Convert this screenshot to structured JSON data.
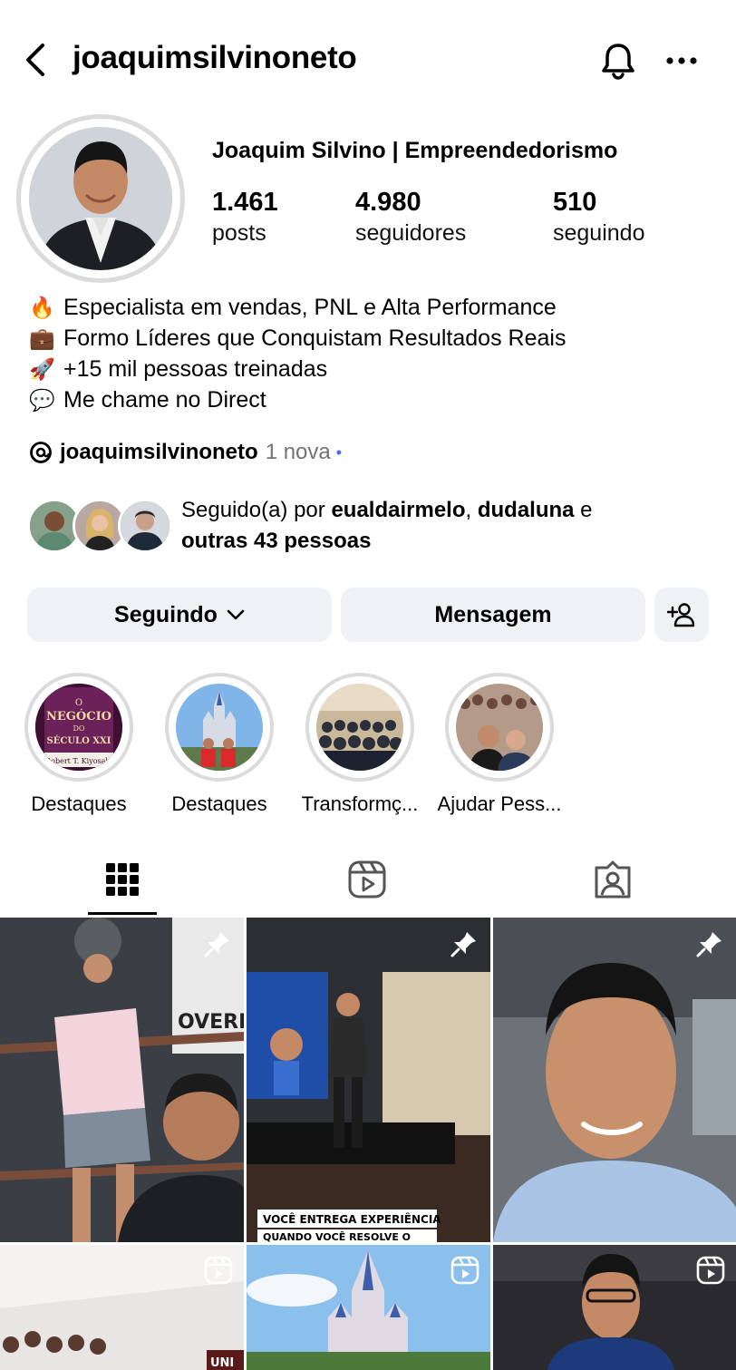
{
  "header": {
    "username": "joaquimsilvinoneto",
    "back_icon": "back-arrow-icon",
    "bell_icon": "bell-icon",
    "more_icon": "more-dots-icon"
  },
  "profile": {
    "display_name": "Joaquim Silvino | Empreendedorismo",
    "stats": {
      "posts": {
        "value": "1.461",
        "label": "posts"
      },
      "followers": {
        "value": "4.980",
        "label": "seguidores"
      },
      "following": {
        "value": "510",
        "label": "seguindo"
      }
    },
    "bio": [
      {
        "emoji": "🔥",
        "text": "Especialista em vendas, PNL e Alta Performance"
      },
      {
        "emoji": "💼",
        "text": "Formo Líderes que Conquistam Resultados Reais"
      },
      {
        "emoji": "🚀",
        "text": "+15 mil pessoas treinadas"
      },
      {
        "emoji": "💬",
        "text": "Me chame no Direct"
      }
    ],
    "threads": {
      "handle": "joaquimsilvinoneto",
      "badge": "1 nova",
      "dot": "•"
    },
    "followed_by": {
      "prefix": "Seguido(a) por ",
      "user1": "eualdairmelo",
      "sep": ", ",
      "user2": "dudaluna",
      "conj": " e",
      "others": "outras 43 pessoas"
    }
  },
  "actions": {
    "following_label": "Seguindo",
    "message_label": "Mensagem",
    "add_user_icon": "add-person-icon"
  },
  "highlights": [
    {
      "label": "Destaques",
      "book_title_1": "O",
      "book_title_2": "NEGÓCIO",
      "book_title_3": "DO",
      "book_title_4": "SÉCULO XXI",
      "book_author": "Robert T. Kiyosaki"
    },
    {
      "label": "Destaques"
    },
    {
      "label": "Transformç..."
    },
    {
      "label": "Ajudar Pess..."
    }
  ],
  "tabs": [
    "grid-icon",
    "reels-icon",
    "tagged-icon"
  ],
  "posts": [
    {
      "type": "pinned",
      "overlay": "OVERNO D"
    },
    {
      "type": "pinned",
      "caption1": "VOCÊ ENTREGA EXPERIÊNCIA",
      "caption2": "QUANDO VOCÊ RESOLVE O"
    },
    {
      "type": "pinned"
    },
    {
      "type": "reel",
      "sign": "UNI"
    },
    {
      "type": "reel"
    },
    {
      "type": "reel"
    }
  ],
  "colors": {
    "button_bg": "#eff1f4",
    "ring": "#dbdbdb",
    "muted": "#737373",
    "dot": "#4a6cf7"
  }
}
